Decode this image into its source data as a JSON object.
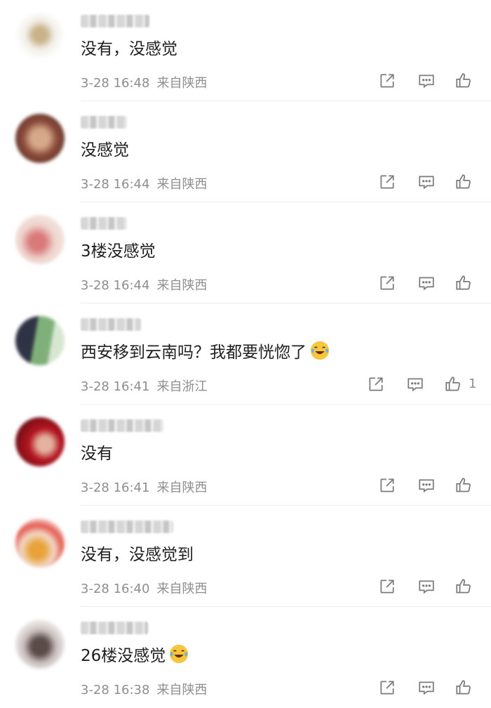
{
  "comments": [
    {
      "text": "没有，没感觉",
      "time": "3-28 16:48",
      "location": "来自陕西",
      "like_count": "",
      "emoji": false
    },
    {
      "text": "没感觉",
      "time": "3-28 16:44",
      "location": "来自陕西",
      "like_count": "",
      "emoji": false
    },
    {
      "text": "3楼没感觉",
      "time": "3-28 16:44",
      "location": "来自陕西",
      "like_count": "",
      "emoji": false
    },
    {
      "text": "西安移到云南吗？我都要恍惚了",
      "time": "3-28 16:41",
      "location": "来自浙江",
      "like_count": "1",
      "emoji": true
    },
    {
      "text": "没有",
      "time": "3-28 16:41",
      "location": "来自陕西",
      "like_count": "",
      "emoji": false
    },
    {
      "text": "没有，没感觉到",
      "time": "3-28 16:40",
      "location": "来自陕西",
      "like_count": "",
      "emoji": false
    },
    {
      "text": "26楼没感觉",
      "time": "3-28 16:38",
      "location": "来自陕西",
      "like_count": "",
      "emoji": true
    }
  ],
  "emoji_name": "laugh-cry-icon",
  "colors": {
    "text": "#1f1f1f",
    "meta": "#8e8e8e",
    "icon": "#7a7a7a",
    "divider": "#ececec"
  }
}
